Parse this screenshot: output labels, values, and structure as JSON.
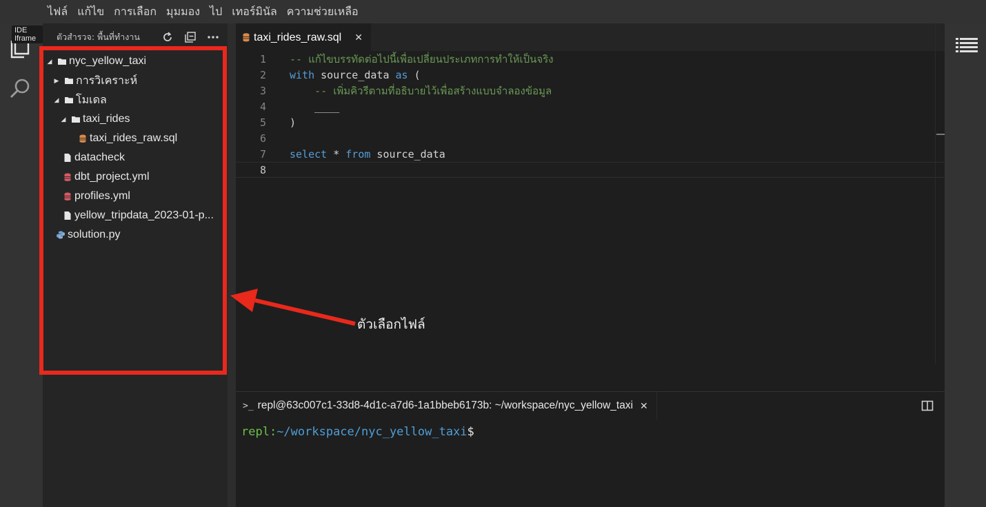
{
  "menu": {
    "items": [
      "ไฟล์",
      "แก้ไข",
      "การเลือก",
      "มุมมอง",
      "ไป",
      "เทอร์มินัล",
      "ความช่วยเหลือ"
    ]
  },
  "activity_bar": {
    "tooltip": "IDE Iframe",
    "icons": [
      "files-icon",
      "search-icon"
    ]
  },
  "sidebar": {
    "header_title": "ตัวสำรวจ: พื้นที่ทำงาน",
    "header_buttons": [
      "refresh-icon",
      "collapse-all-icon",
      "more-icon"
    ],
    "tree": [
      {
        "label": "nyc_yellow_taxi",
        "type": "folder",
        "expanded": true
      },
      {
        "label": "การวิเคราะห์",
        "type": "folder",
        "expanded": false
      },
      {
        "label": "โมเดล",
        "type": "folder",
        "expanded": true
      },
      {
        "label": "taxi_rides",
        "type": "folder",
        "expanded": true
      },
      {
        "label": "taxi_rides_raw.sql",
        "type": "sql"
      },
      {
        "label": "datacheck",
        "type": "file"
      },
      {
        "label": "dbt_project.yml",
        "type": "yml"
      },
      {
        "label": "profiles.yml",
        "type": "yml"
      },
      {
        "label": "yellow_tripdata_2023-01-p...",
        "type": "file"
      },
      {
        "label": "solution.py",
        "type": "python"
      }
    ]
  },
  "annotation": {
    "label": "ตัวเลือกไฟล์",
    "color": "#e8291c"
  },
  "editor": {
    "tab_label": "taxi_rides_raw.sql",
    "line_numbers": [
      "1",
      "2",
      "3",
      "4",
      "5",
      "6",
      "7",
      "8"
    ],
    "lines": {
      "l1_comment": "-- แก้ไขบรรทัดต่อไปนี้เพื่อเปลี่ยนประเภทการทำให้เป็นจริง",
      "l2_kw1": "with",
      "l2_name": " source_data ",
      "l2_kw2": "as",
      "l2_paren": " (",
      "l3_comment": "    -- เพิ่มคิวรีตามที่อธิบายไว้เพื่อสร้างแบบจำลองข้อมูล",
      "l4_blank": "    ____",
      "l5_paren": ")",
      "l7_kw1": "select",
      "l7_star": " * ",
      "l7_kw2": "from",
      "l7_name": " source_data"
    }
  },
  "terminal": {
    "tab_icon": ">_",
    "tab_label": "repl@63c007c1-33d8-4d1c-a7d6-1a1bbeb6173b: ~/workspace/nyc_yellow_taxi",
    "prompt_user": "repl:",
    "prompt_path": "~/workspace/nyc_yellow_taxi",
    "prompt_symbol": "$"
  },
  "colors": {
    "comment": "#6a9955",
    "keyword": "#569cd6",
    "terminal_user": "#6cc04a",
    "terminal_path": "#4e9ed8"
  }
}
